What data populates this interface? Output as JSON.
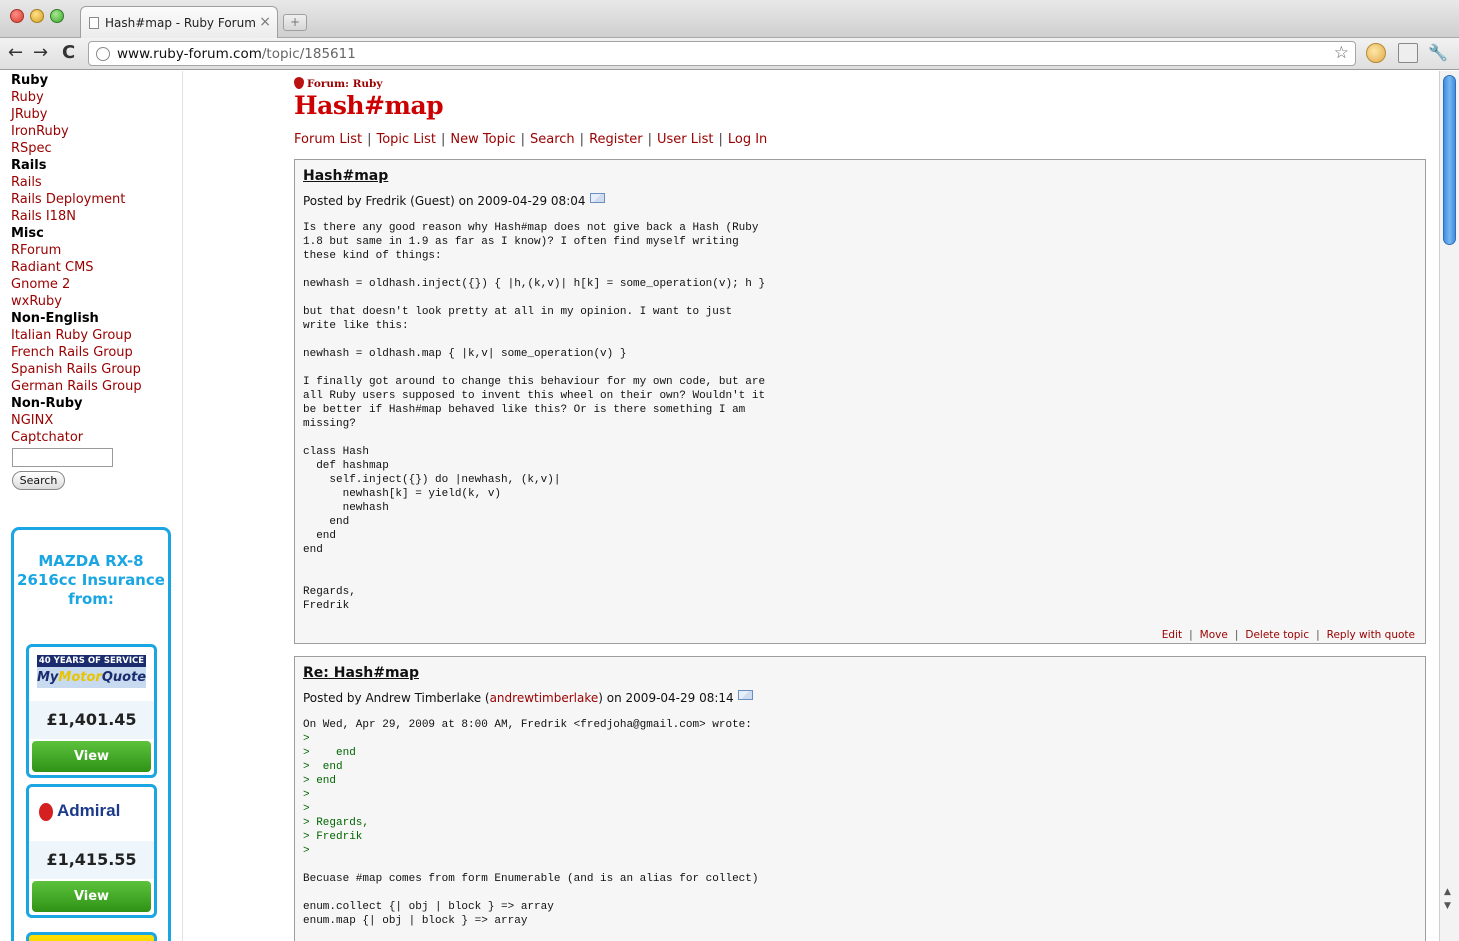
{
  "browser": {
    "tab_title": "Hash#map - Ruby Forum",
    "tab_close": "×",
    "new_tab": "+",
    "url_host": "www.ruby-forum.com",
    "url_path": "/topic/185611",
    "back": "←",
    "forward": "→",
    "reload": "C",
    "star": "☆",
    "wrench": "🔧"
  },
  "sidebar": {
    "items": [
      {
        "label": "Ruby",
        "type": "head"
      },
      {
        "label": "Ruby",
        "type": "link"
      },
      {
        "label": "JRuby",
        "type": "link"
      },
      {
        "label": "IronRuby",
        "type": "link"
      },
      {
        "label": "RSpec",
        "type": "link"
      },
      {
        "label": "Rails",
        "type": "head"
      },
      {
        "label": "Rails",
        "type": "link"
      },
      {
        "label": "Rails Deployment",
        "type": "link"
      },
      {
        "label": "Rails I18N",
        "type": "link"
      },
      {
        "label": "Misc",
        "type": "head"
      },
      {
        "label": "RForum",
        "type": "link"
      },
      {
        "label": "Radiant CMS",
        "type": "link"
      },
      {
        "label": "Gnome 2",
        "type": "link"
      },
      {
        "label": "wxRuby",
        "type": "link"
      },
      {
        "label": "Non-English",
        "type": "head"
      },
      {
        "label": "Italian Ruby Group",
        "type": "link"
      },
      {
        "label": "French Rails Group",
        "type": "link"
      },
      {
        "label": "Spanish Rails Group",
        "type": "link"
      },
      {
        "label": "German Rails Group",
        "type": "link"
      },
      {
        "label": "Non-Ruby",
        "type": "head"
      },
      {
        "label": "NGINX",
        "type": "link"
      },
      {
        "label": "Captchator",
        "type": "link"
      }
    ],
    "search_value": "",
    "search_button": "Search"
  },
  "ad": {
    "headline_1": "MAZDA RX-8",
    "headline_2": "2616cc Insurance",
    "headline_3": "from:",
    "card1": {
      "logo_top": "40 YEARS OF SERVICE",
      "logo_a": "My",
      "logo_b": "Motor",
      "logo_c": "Quote",
      "price": "£1,401.45",
      "button": "View"
    },
    "card2": {
      "logo": "Admiral",
      "price": "£1,415.55",
      "button": "View"
    }
  },
  "main": {
    "forum_label": "Forum: Ruby",
    "title": "Hash#map",
    "nav": [
      "Forum List",
      "Topic List",
      "New Topic",
      "Search",
      "Register",
      "User List",
      "Log In"
    ],
    "posts": [
      {
        "title": "Hash#map",
        "meta_prefix": "Posted by Fredrik (Guest) on 2009-04-29 08:04",
        "body": "Is there any good reason why Hash#map does not give back a Hash (Ruby\n1.8 but same in 1.9 as far as I know)? I often find myself writing\nthese kind of things:\n\nnewhash = oldhash.inject({}) { |h,(k,v)| h[k] = some_operation(v); h }\n\nbut that doesn't look pretty at all in my opinion. I want to just\nwrite like this:\n\nnewhash = oldhash.map { |k,v| some_operation(v) }\n\nI finally got around to change this behaviour for my own code, but are\nall Ruby users supposed to invent this wheel on their own? Wouldn't it\nbe better if Hash#map behaved like this? Or is there something I am\nmissing?\n\nclass Hash\n  def hashmap\n    self.inject({}) do |newhash, (k,v)|\n      newhash[k] = yield(k, v)\n      newhash\n    end\n  end\nend\n\n\nRegards,\nFredrik",
        "actions": [
          "Edit",
          "Move",
          "Delete topic",
          "Reply with quote"
        ]
      },
      {
        "title": "Re: Hash#map",
        "meta_prefix": "Posted by Andrew Timberlake (",
        "meta_user": "andrewtimberlake",
        "meta_suffix": ") on 2009-04-29 08:14",
        "body_intro": "On Wed, Apr 29, 2009 at 8:00 AM, Fredrik <fredjoha@gmail.com> wrote:",
        "quoted": ">\n>    end\n>  end\n> end\n>\n>\n> Regards,\n> Fredrik\n>",
        "body_rest": "Becuase #map comes from form Enumerable (and is an alias for collect)\n\nenum.collect {| obj | block } => array\nenum.map {| obj | block } => array"
      }
    ]
  }
}
